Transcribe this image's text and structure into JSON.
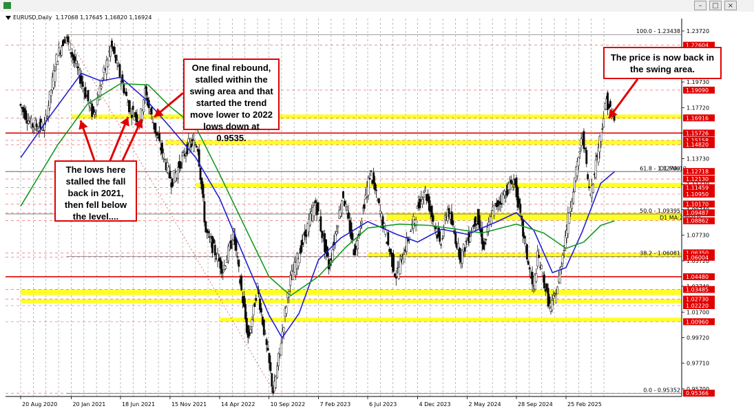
{
  "window": {
    "info_symbol": "EURUSD,Daily",
    "info_ohlc": "1.17068 1.17645 1.16820 1.16924",
    "min_label": "–",
    "restore_label": "□",
    "close_label": "×"
  },
  "callouts": {
    "lows": "The lows here stalled the fall back in 2021, then fell below the level....",
    "rebound": "One final rebound, stalled within the swing area and that started the trend move lower to 2022 lows down at 0.9535.",
    "price": "The price is now back in the swing area."
  },
  "colors": {
    "bull_candle": "#0a0a0a",
    "bear_candle": "#0a0a0a",
    "ma100": "#1f1fd0",
    "ma200": "#129a1e",
    "swing_zone": "#ffff00",
    "support_line": "#e00000",
    "price_tag": "#e00000",
    "grid": "#9aa0a6"
  },
  "chart_data": {
    "type": "candlestick",
    "symbol": "EURUSD",
    "timeframe": "Daily",
    "ylim": [
      0.95,
      1.245
    ],
    "y_ticks": [
      "1.23720",
      "1.21710",
      "1.19730",
      "1.17720",
      "1.15740",
      "1.13730",
      "1.11720",
      "1.09740",
      "1.07730",
      "1.05720",
      "1.03740",
      "1.01700",
      "0.99720",
      "0.97710",
      "0.95700"
    ],
    "x_tick_labels": [
      "20 Aug 2020",
      "20 Jan 2021",
      "18 Jun 2021",
      "15 Nov 2021",
      "14 Apr 2022",
      "10 Sep 2022",
      "7 Feb 2023",
      "6 Jul 2023",
      "4 Dec 2023",
      "2 May 2024",
      "28 Sep 2024",
      "25 Feb 2025"
    ],
    "x_tick_values": [
      "2020-08-20",
      "2021-01-20",
      "2021-06-18",
      "2021-11-15",
      "2022-04-14",
      "2022-09-10",
      "2023-02-07",
      "2023-07-06",
      "2023-12-04",
      "2024-05-02",
      "2024-09-28",
      "2025-02-25"
    ],
    "price_path": [
      [
        "2020-08-20",
        1.18
      ],
      [
        "2020-09-25",
        1.164
      ],
      [
        "2020-11-04",
        1.162
      ],
      [
        "2020-12-10",
        1.215
      ],
      [
        "2021-01-06",
        1.234
      ],
      [
        "2021-03-31",
        1.171
      ],
      [
        "2021-05-25",
        1.226
      ],
      [
        "2021-07-20",
        1.176
      ],
      [
        "2021-08-20",
        1.167
      ],
      [
        "2021-09-03",
        1.19
      ],
      [
        "2021-10-12",
        1.153
      ],
      [
        "2021-11-24",
        1.119
      ],
      [
        "2022-01-14",
        1.148
      ],
      [
        "2022-02-10",
        1.149
      ],
      [
        "2022-03-07",
        1.08
      ],
      [
        "2022-04-28",
        1.05
      ],
      [
        "2022-05-30",
        1.078
      ],
      [
        "2022-07-14",
        0.995
      ],
      [
        "2022-08-10",
        1.037
      ],
      [
        "2022-09-28",
        0.9535
      ],
      [
        "2022-11-15",
        1.04
      ],
      [
        "2023-02-02",
        1.103
      ],
      [
        "2023-03-15",
        1.052
      ],
      [
        "2023-04-26",
        1.11
      ],
      [
        "2023-05-31",
        1.063
      ],
      [
        "2023-07-18",
        1.127
      ],
      [
        "2023-10-03",
        1.045
      ],
      [
        "2023-12-28",
        1.114
      ],
      [
        "2024-02-14",
        1.07
      ],
      [
        "2024-03-08",
        1.098
      ],
      [
        "2024-04-16",
        1.06
      ],
      [
        "2024-06-04",
        1.092
      ],
      [
        "2024-06-26",
        1.067
      ],
      [
        "2024-07-18",
        1.095
      ],
      [
        "2024-09-25",
        1.121
      ],
      [
        "2024-10-23",
        1.077
      ],
      [
        "2024-11-22",
        1.033
      ],
      [
        "2024-12-06",
        1.062
      ],
      [
        "2025-01-13",
        1.018
      ],
      [
        "2025-02-04",
        1.038
      ],
      [
        "2025-03-10",
        1.095
      ],
      [
        "2025-04-21",
        1.157
      ],
      [
        "2025-05-12",
        1.107
      ],
      [
        "2025-06-06",
        1.145
      ],
      [
        "2025-07-01",
        1.183
      ],
      [
        "2025-07-22",
        1.1692
      ]
    ],
    "ma100": [
      [
        "2020-08-20",
        1.138
      ],
      [
        "2020-11-15",
        1.17
      ],
      [
        "2021-02-20",
        1.204
      ],
      [
        "2021-04-20",
        1.198
      ],
      [
        "2021-06-18",
        1.201
      ],
      [
        "2021-09-01",
        1.184
      ],
      [
        "2021-11-15",
        1.162
      ],
      [
        "2022-02-01",
        1.138
      ],
      [
        "2022-04-14",
        1.106
      ],
      [
        "2022-07-01",
        1.058
      ],
      [
        "2022-09-10",
        1.015
      ],
      [
        "2022-10-20",
        0.997
      ],
      [
        "2022-12-10",
        1.016
      ],
      [
        "2023-02-07",
        1.058
      ],
      [
        "2023-04-15",
        1.075
      ],
      [
        "2023-07-06",
        1.088
      ],
      [
        "2023-10-01",
        1.078
      ],
      [
        "2023-12-04",
        1.072
      ],
      [
        "2024-02-15",
        1.082
      ],
      [
        "2024-05-02",
        1.078
      ],
      [
        "2024-08-01",
        1.088
      ],
      [
        "2024-09-28",
        1.095
      ],
      [
        "2024-11-20",
        1.081
      ],
      [
        "2025-01-15",
        1.048
      ],
      [
        "2025-02-25",
        1.052
      ],
      [
        "2025-04-15",
        1.08
      ],
      [
        "2025-06-10",
        1.118
      ],
      [
        "2025-07-22",
        1.1271
      ]
    ],
    "ma200": [
      [
        "2020-08-20",
        1.1
      ],
      [
        "2020-12-10",
        1.148
      ],
      [
        "2021-03-10",
        1.18
      ],
      [
        "2021-06-18",
        1.196
      ],
      [
        "2021-09-10",
        1.195
      ],
      [
        "2021-11-15",
        1.178
      ],
      [
        "2022-02-01",
        1.162
      ],
      [
        "2022-04-14",
        1.125
      ],
      [
        "2022-07-01",
        1.083
      ],
      [
        "2022-09-10",
        1.045
      ],
      [
        "2022-11-15",
        1.03
      ],
      [
        "2023-02-07",
        1.045
      ],
      [
        "2023-05-01",
        1.068
      ],
      [
        "2023-07-06",
        1.083
      ],
      [
        "2023-10-10",
        1.086
      ],
      [
        "2024-01-10",
        1.085
      ],
      [
        "2024-04-01",
        1.082
      ],
      [
        "2024-06-15",
        1.079
      ],
      [
        "2024-09-28",
        1.086
      ],
      [
        "2024-12-20",
        1.079
      ],
      [
        "2025-02-25",
        1.067
      ],
      [
        "2025-04-20",
        1.072
      ],
      [
        "2025-06-10",
        1.085
      ],
      [
        "2025-07-22",
        1.0886
      ]
    ],
    "fib_trend_points": [
      [
        "2021-01-06",
        1.2344
      ],
      [
        "2022-09-28",
        0.9535
      ]
    ],
    "swing_zones": [
      {
        "low": 1.16916,
        "high": 1.1718,
        "start": "2021-01-20"
      },
      {
        "low": 1.1482,
        "high": 1.1516,
        "start": "2021-11-01"
      },
      {
        "low": 1.11459,
        "high": 1.1183,
        "start": "2022-02-01"
      },
      {
        "low": 1.089,
        "high": 1.09487,
        "start": "2023-09-01"
      },
      {
        "low": 1.06004,
        "high": 1.0635,
        "start": "2023-07-06"
      },
      {
        "low": 1.0305,
        "high": 1.03485,
        "start": "2020-08-20"
      },
      {
        "low": 1.025,
        "high": 1.0273,
        "start": "2020-08-20"
      },
      {
        "low": 1.0096,
        "high": 1.0128,
        "start": "2022-04-14"
      }
    ],
    "red_levels": [
      1.15726,
      1.0448
    ],
    "dark_levels": [
      1.12718,
      1.09395
    ],
    "fib_levels": [
      {
        "label": "100.0 - 1.23438",
        "value": 1.23438
      },
      {
        "label": "61.8 - 1.12709",
        "value": 1.12709
      },
      {
        "label": "50.0 - 1.09395",
        "value": 1.09395
      },
      {
        "label": "38.2 - 1.06081",
        "value": 1.06081
      },
      {
        "label": "0.0 - 0.95352",
        "value": 0.95352
      }
    ],
    "ma_labels": [
      {
        "label": "D1 MA:10",
        "value": 1.12709
      },
      {
        "label": "D1 MA:200:0.0",
        "value": 1.08855
      }
    ],
    "price_tags": [
      {
        "label": "1.22604",
        "value": 1.22604,
        "style": "red"
      },
      {
        "label": "1.19090",
        "value": 1.1909,
        "style": "red"
      },
      {
        "label": "1.16916",
        "value": 1.16916,
        "style": "red"
      },
      {
        "label": "1.15726",
        "value": 1.15726,
        "style": "red"
      },
      {
        "label": "1.15158",
        "value": 1.15158,
        "style": "red"
      },
      {
        "label": "1.14820",
        "value": 1.1482,
        "style": "red"
      },
      {
        "label": "1.12718",
        "value": 1.12718,
        "style": "red"
      },
      {
        "label": "1.12130",
        "value": 1.1213,
        "style": "red"
      },
      {
        "label": "1.11459",
        "value": 1.11459,
        "style": "red"
      },
      {
        "label": "1.10950",
        "value": 1.1095,
        "style": "red"
      },
      {
        "label": "1.10170",
        "value": 1.1017,
        "style": "red"
      },
      {
        "label": "1.09487",
        "value": 1.09487,
        "style": "red"
      },
      {
        "label": "1.08862",
        "value": 1.08862,
        "style": "red"
      },
      {
        "label": "1.06350",
        "value": 1.0635,
        "style": "red"
      },
      {
        "label": "1.06004",
        "value": 1.06004,
        "style": "red"
      },
      {
        "label": "1.04480",
        "value": 1.0448,
        "style": "red"
      },
      {
        "label": "1.03485",
        "value": 1.03485,
        "style": "red"
      },
      {
        "label": "1.02730",
        "value": 1.0273,
        "style": "red"
      },
      {
        "label": "1.02220",
        "value": 1.0222,
        "style": "red"
      },
      {
        "label": "1.00960",
        "value": 1.0096,
        "style": "red"
      },
      {
        "label": "0.95366",
        "value": 0.95366,
        "style": "red"
      }
    ]
  }
}
